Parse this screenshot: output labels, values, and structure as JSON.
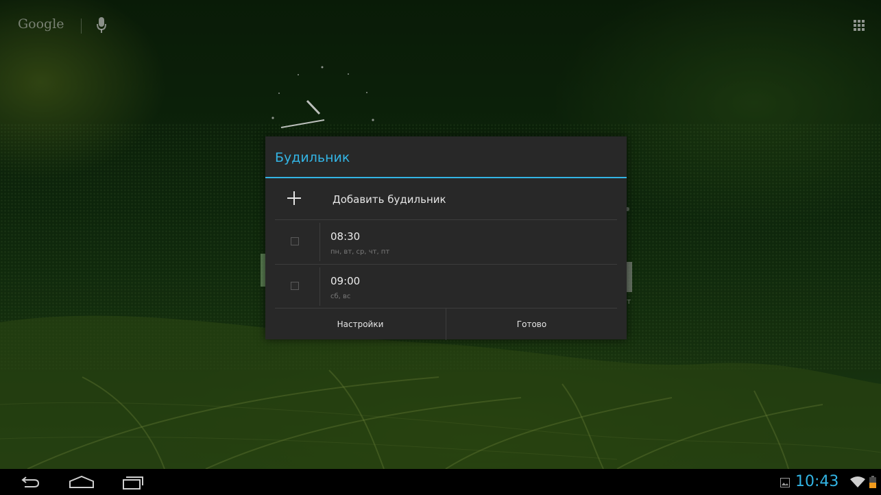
{
  "search_bar": {
    "logo_text": "Google"
  },
  "dialog": {
    "title": "Будильник",
    "add_alarm_label": "Добавить будильник",
    "alarms": [
      {
        "time": "08:30",
        "days": "пн, вт, ср, чт, пт",
        "enabled": false
      },
      {
        "time": "09:00",
        "days": "сб, вс",
        "enabled": false
      }
    ],
    "buttons": {
      "settings": "Настройки",
      "done": "Готово"
    }
  },
  "background_fragment": {
    "partial_label": "т"
  },
  "status_bar": {
    "time": "10:43"
  },
  "colors": {
    "accent": "#33b5e5",
    "dialog_bg": "#282828",
    "navbar_bg": "#000000"
  },
  "icons": {
    "mic": "mic-icon",
    "apps": "apps-grid-icon",
    "add": "plus-icon",
    "back": "back-icon",
    "home": "home-icon",
    "recents": "recents-icon",
    "gallery": "gallery-icon",
    "wifi": "wifi-icon",
    "battery": "battery-icon"
  }
}
